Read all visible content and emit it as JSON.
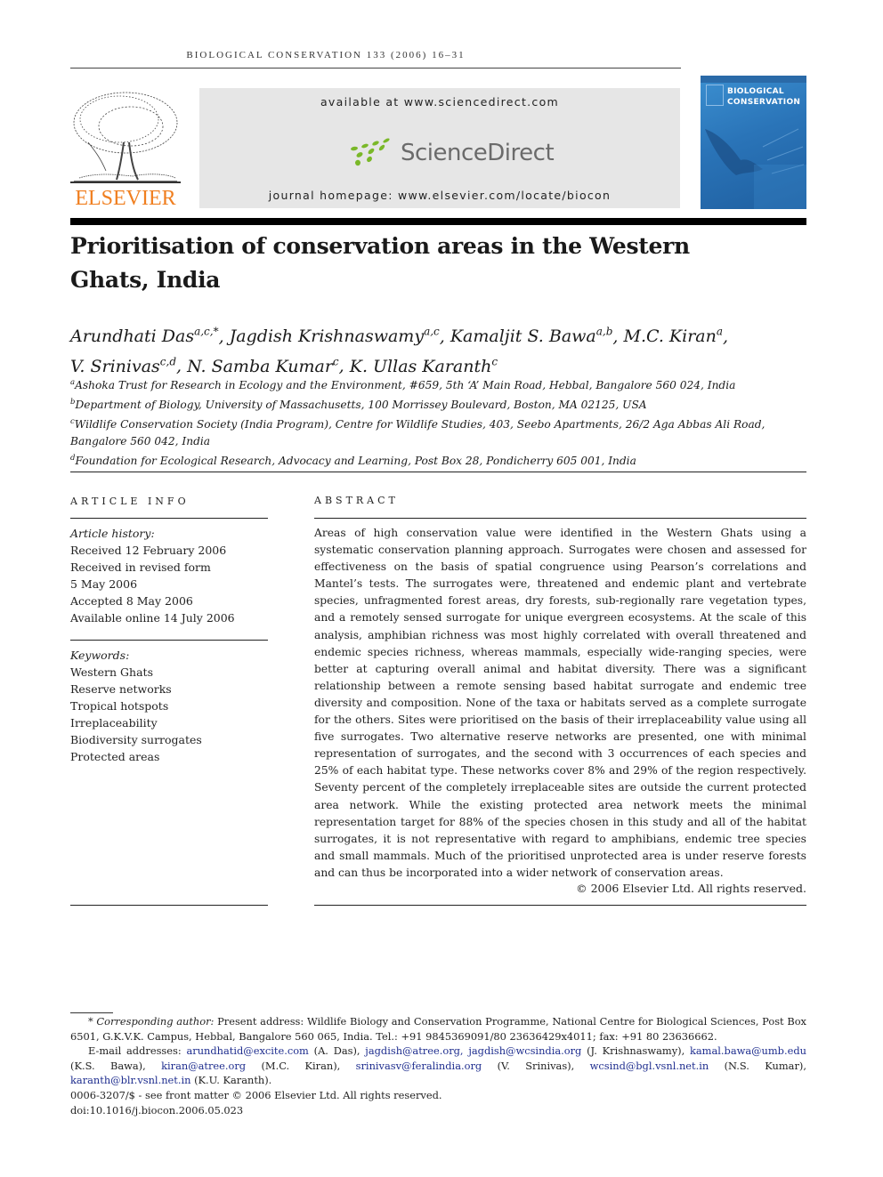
{
  "running_head": "BIOLOGICAL CONSERVATION 133 (2006) 16–31",
  "header": {
    "publisher_name": "ELSEVIER",
    "available_at": "available at www.sciencedirect.com",
    "sciencedirect_logo": "ScienceDirect",
    "journal_homepage": "journal homepage: www.elsevier.com/locate/biocon",
    "cover_title_line1": "BIOLOGICAL",
    "cover_title_line2": "CONSERVATION",
    "colors": {
      "elsevier_orange": "#f07f20",
      "sciencedirect_green": "#7ab828",
      "cover_blue": "#2a74b8",
      "link_blue": "#1f2e8f"
    }
  },
  "title": "Prioritisation of conservation areas in the Western Ghats, India",
  "authors": [
    {
      "name": "Arundhati Das",
      "sup": "a,c,*"
    },
    {
      "name": "Jagdish Krishnaswamy",
      "sup": "a,c"
    },
    {
      "name": "Kamaljit S. Bawa",
      "sup": "a,b"
    },
    {
      "name": "M.C. Kiran",
      "sup": "a"
    },
    {
      "name": "V. Srinivas",
      "sup": "c,d"
    },
    {
      "name": "N. Samba Kumar",
      "sup": "c"
    },
    {
      "name": "K. Ullas Karanth",
      "sup": "c"
    }
  ],
  "affiliations": [
    {
      "key": "a",
      "text": "Ashoka Trust for Research in Ecology and the Environment, #659, 5th ‘A’ Main Road, Hebbal, Bangalore 560 024, India"
    },
    {
      "key": "b",
      "text": "Department of Biology, University of Massachusetts, 100 Morrissey Boulevard, Boston, MA 02125, USA"
    },
    {
      "key": "c",
      "text": "Wildlife Conservation Society (India Program), Centre for Wildlife Studies, 403, Seebo Apartments, 26/2 Aga Abbas Ali Road, Bangalore 560 042, India"
    },
    {
      "key": "d",
      "text": "Foundation for Ecological Research, Advocacy and Learning, Post Box 28, Pondicherry 605 001, India"
    }
  ],
  "article_info": {
    "heading": "ARTICLE INFO",
    "history_label": "Article history:",
    "history": [
      "Received 12 February 2006",
      "Received in revised form",
      "5 May 2006",
      "Accepted 8 May 2006",
      "Available online 14 July 2006"
    ],
    "keywords_label": "Keywords:",
    "keywords": [
      "Western Ghats",
      "Reserve networks",
      "Tropical hotspots",
      "Irreplaceability",
      "Biodiversity surrogates",
      "Protected areas"
    ]
  },
  "abstract": {
    "heading": "ABSTRACT",
    "text": "Areas of high conservation value were identified in the Western Ghats using a systematic conservation planning approach. Surrogates were chosen and assessed for effectiveness on the basis of spatial congruence using Pearson’s correlations and Mantel’s tests. The surrogates were, threatened and endemic plant and vertebrate species, unfragmented forest areas, dry forests, sub-regionally rare vegetation types, and a remotely sensed sur­rogate for unique evergreen ecosystems. At the scale of this analysis, amphibian richness was most highly correlated with overall threatened and endemic species richness, whereas mammals, especially wide-ranging species, were better at capturing overall ani­mal and habitat diversity. There was a significant relationship between a remote sensing based habitat surrogate and endemic tree diversity and composition. None of the taxa or habitats served as a complete surrogate for the others. Sites were prioritised on the basis of their irreplaceability value using all five surrogates. Two alternative reserve networks are presented, one with minimal representation of surrogates, and the second with 3 occurrences of each species and 25% of each habitat type. These networks cover 8% and 29% of the region respectively. Seventy percent of the completely irreplaceable sites are outside the current protected area network. While the existing protected area net­work meets the minimal representation target for 88% of the species chosen in this study and all of the habitat surrogates, it is not representative with regard to amphibians, endemic tree species and small mammals. Much of the prioritised unprotected area is under reserve forests and can thus be incorporated into a wider network of conservation areas.",
    "copyright": "© 2006 Elsevier Ltd. All rights reserved."
  },
  "footnotes": {
    "corresponding_label": "Corresponding author:",
    "corresponding_marker": "*",
    "corresponding_text": "Present address: Wildlife Biology and Conservation Programme, National Centre for Biological Sciences, Post Box 6501, G.K.V.K. Campus, Hebbal, Bangalore 560 065, India. Tel.: +91 9845369091/80 23636429x4011; fax: +91 80 23636662.",
    "email_label": "E-mail addresses:",
    "emails": [
      {
        "address": "arundhatid@excite.com",
        "owner": "(A. Das),"
      },
      {
        "address": "jagdish@atree.org,",
        "owner": ""
      },
      {
        "address": "jagdish@wcsindia.org",
        "owner": "(J. Krishnaswamy),"
      },
      {
        "address": "kamal.bawa@umb.edu",
        "owner": "(K.S. Bawa),"
      },
      {
        "address": "kiran@atree.org",
        "owner": "(M.C. Kiran),"
      },
      {
        "address": "srinivasv@feralindia.org",
        "owner": "(V. Srinivas),"
      },
      {
        "address": "wcsind@bgl.vsnl.net.in",
        "owner": "(N.S. Kumar),"
      },
      {
        "address": "karanth@blr.vsnl.net.in",
        "owner": "(K.U. Karanth)."
      }
    ],
    "front_matter": "0006-3207/$ - see front matter © 2006 Elsevier Ltd. All rights reserved.",
    "doi": "doi:10.1016/j.biocon.2006.05.023"
  }
}
